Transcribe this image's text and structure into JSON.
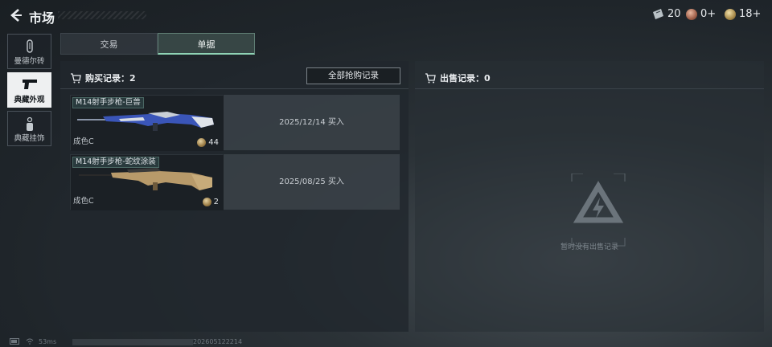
{
  "header": {
    "title": "市场",
    "currencies": [
      {
        "value": "20",
        "icon": "ticket-icon"
      },
      {
        "value": "0+",
        "icon": "badge-coin-icon"
      },
      {
        "value": "18+",
        "icon": "gold-coin-icon"
      }
    ]
  },
  "sidebar": {
    "items": [
      {
        "label": "曼德尔砖",
        "icon": "brick-icon",
        "active": false
      },
      {
        "label": "典藏外观",
        "icon": "pistol-icon",
        "active": true
      },
      {
        "label": "典藏挂饰",
        "icon": "charm-icon",
        "active": false
      }
    ]
  },
  "tabs": [
    {
      "label": "交易",
      "active": false
    },
    {
      "label": "单据",
      "active": true
    }
  ],
  "purchase": {
    "heading": "购买记录：2",
    "all_button": "全部抢购记录",
    "records": [
      {
        "name": "M14射手步枪-巨兽",
        "condition": "成色C",
        "price": "44",
        "info": "2025/12/14 买入"
      },
      {
        "name": "M14射手步枪-蛇纹涂装",
        "condition": "成色C",
        "price": "2",
        "info": "2025/08/25 买入"
      }
    ]
  },
  "sales": {
    "heading": "出售记录：0",
    "empty_text": "暂时没有出售记录"
  },
  "footer": {
    "ping": "53ms",
    "build": "202605122214"
  },
  "colors": {
    "tab_accent": "#8fd3b5",
    "active_nav_bg": "#eef0f1"
  }
}
